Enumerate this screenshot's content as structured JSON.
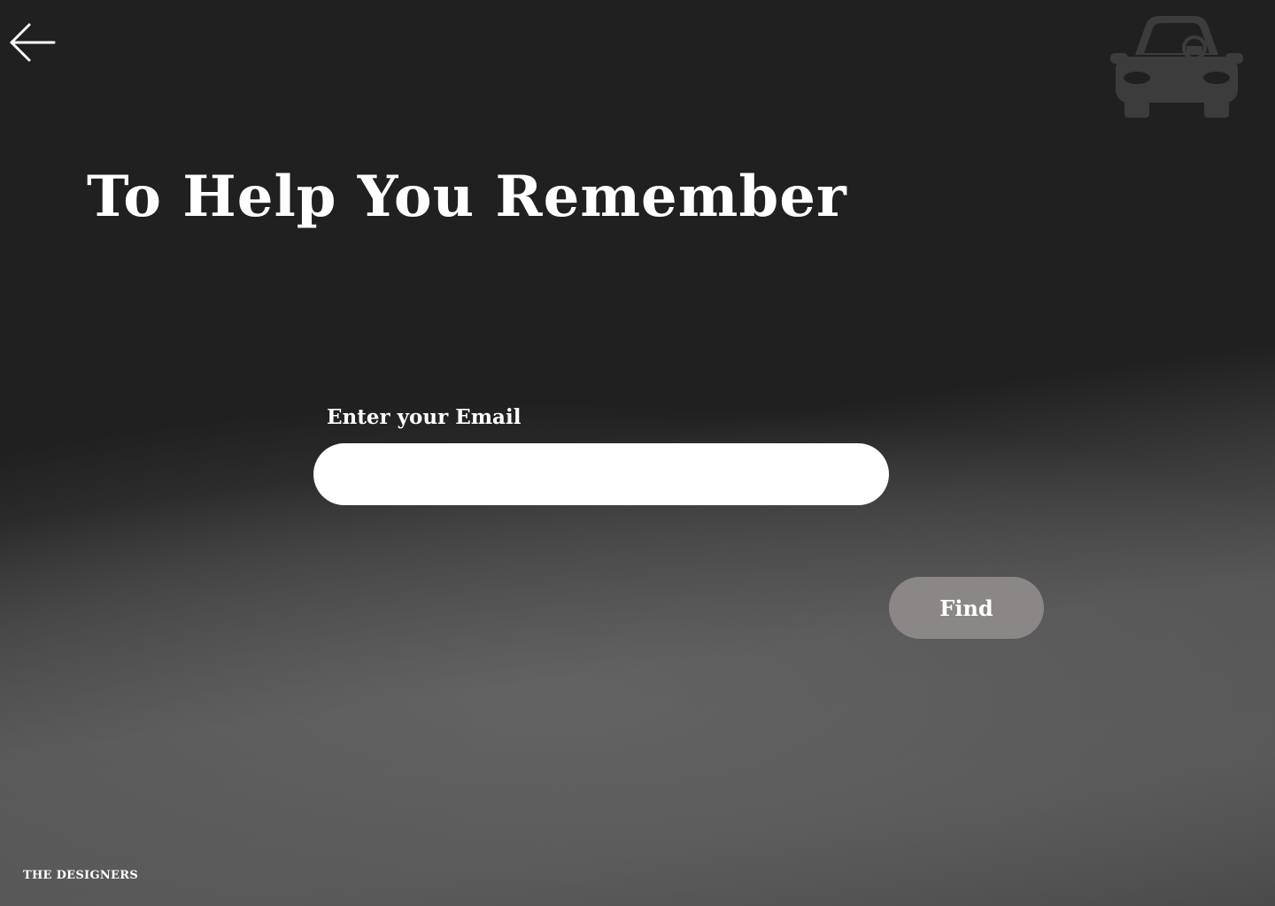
{
  "header": {
    "back_icon": "arrow-left-icon",
    "logo_icon": "car-icon"
  },
  "main": {
    "title": "To Help You Remember",
    "email_label": "Enter your Email",
    "email_value": "",
    "email_placeholder": "",
    "find_label": "Find"
  },
  "footer": {
    "brand": "THE DESIGNERS"
  },
  "colors": {
    "background": "#202020",
    "band": "#575757",
    "input": "#ffffff",
    "button": "#8b8787",
    "text": "#ffffff",
    "logo": "#3c3c3c"
  }
}
